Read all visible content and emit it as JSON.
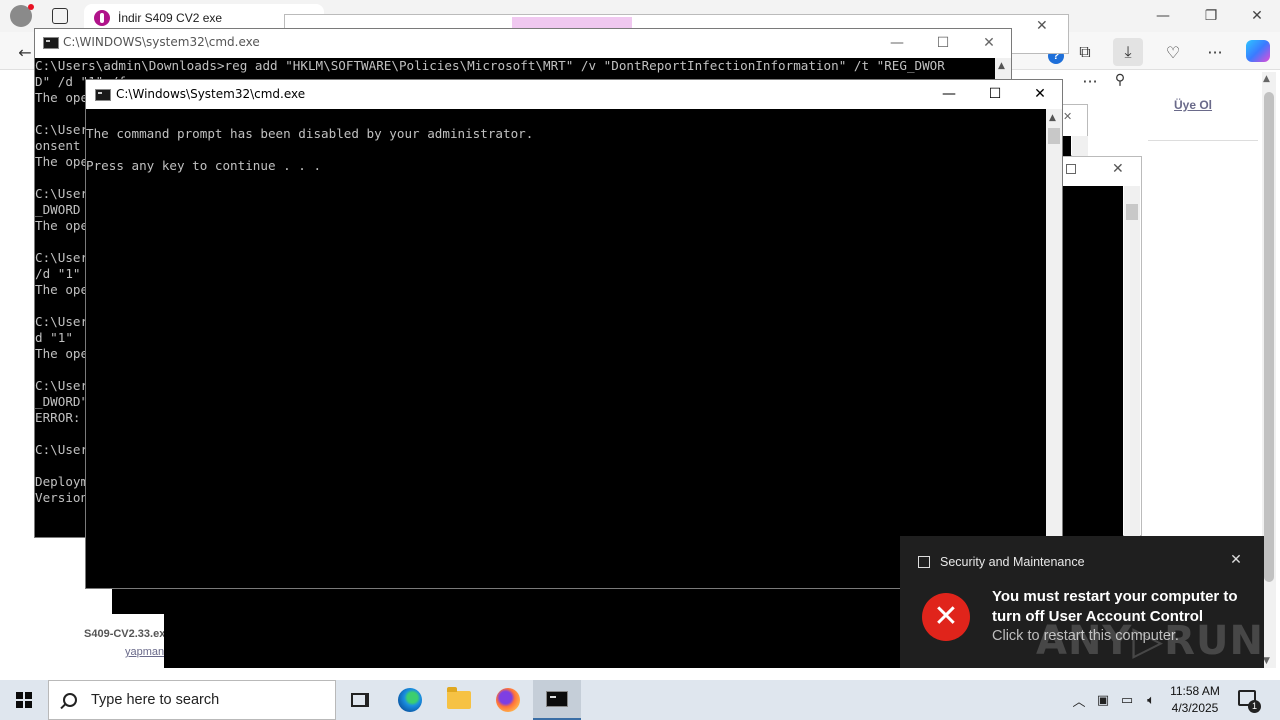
{
  "browser": {
    "tab_title": "İndir S409 CV2 exe",
    "minimize_glyph": "—",
    "restore_glyph": "❐",
    "close_glyph": "✕",
    "help_glyph": "?",
    "menu_glyph": "···",
    "signup_link": "Üye Ol",
    "file_name": "S409-CV2.33.ex",
    "file_link": "yapman"
  },
  "cmd_back": {
    "title": "C:\\WINDOWS\\system32\\cmd.exe",
    "lines": [
      "C:\\Users\\admin\\Downloads>reg add \"HKLM\\SOFTWARE\\Policies\\Microsoft\\MRT\" /v \"DontReportInfectionInformation\" /t \"REG_DWOR",
      "D\" /d \"1\" /f",
      "The ope",
      "",
      "C:\\User",
      "onsent",
      "The ope",
      "",
      "C:\\User",
      "_DWORD",
      "The ope",
      "",
      "C:\\User",
      "/d \"1\"",
      "The ope",
      "",
      "C:\\User",
      "d \"1\"",
      "The ope",
      "",
      "C:\\User",
      "_DWORD\"",
      "ERROR:",
      "",
      "C:\\User",
      "",
      "Deploym",
      "Version"
    ]
  },
  "cmd_front": {
    "title": "C:\\Windows\\System32\\cmd.exe",
    "line1": "The command prompt has been disabled by your administrator.",
    "line2": "Press any key to continue . . ."
  },
  "toast": {
    "app_name": "Security and Maintenance",
    "heading": "You must restart your computer to turn off User Account Control",
    "body": "Click to restart this computer.",
    "close_glyph": "✕",
    "error_glyph": "✕"
  },
  "watermark": "ANY▷RUN",
  "taskbar": {
    "search_placeholder": "Type here to search",
    "time": "11:58 AM",
    "date": "4/3/2025",
    "notification_count": "1",
    "tray_chevron": "︿"
  }
}
